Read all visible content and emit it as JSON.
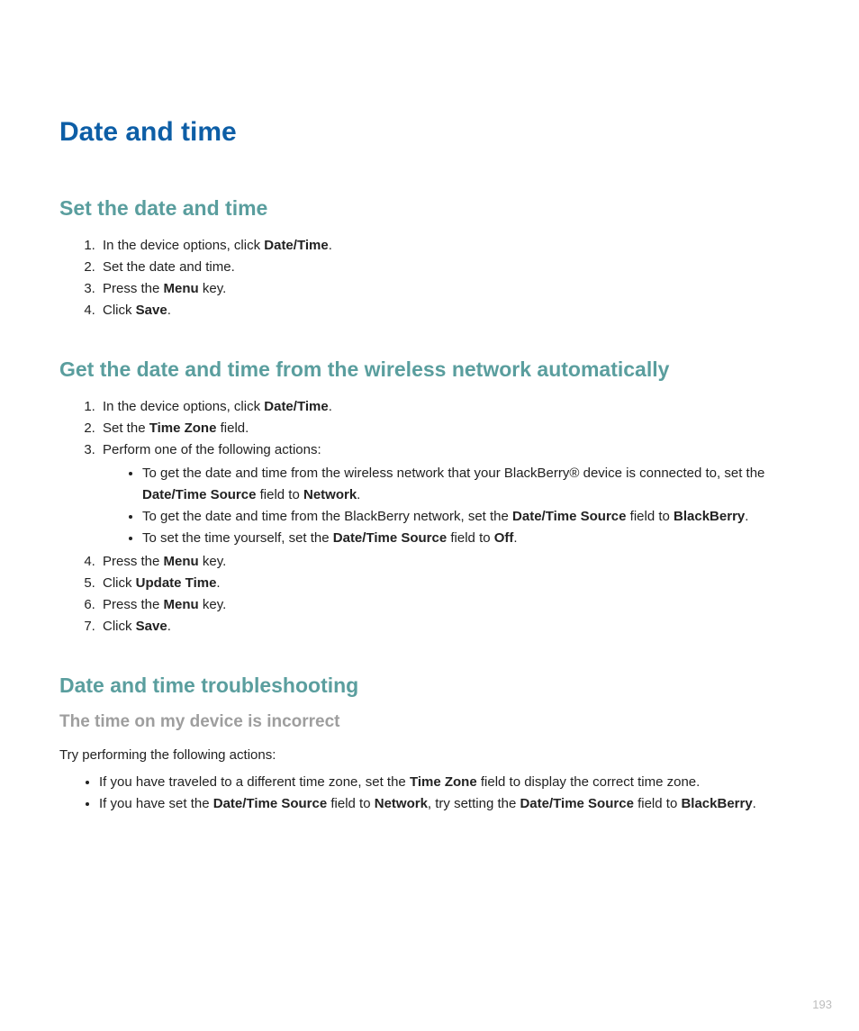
{
  "title": "Date and time",
  "page_number": "193",
  "s1": {
    "heading": "Set the date and time",
    "step1a": "In the device options, click ",
    "step1b": "Date/Time",
    "step1c": ".",
    "step2": "Set the date and time.",
    "step3a": "Press the ",
    "step3b": "Menu",
    "step3c": " key.",
    "step4a": "Click ",
    "step4b": "Save",
    "step4c": "."
  },
  "s2": {
    "heading": "Get the date and time from the wireless network automatically",
    "step1a": "In the device options, click ",
    "step1b": "Date/Time",
    "step1c": ".",
    "step2a": "Set the ",
    "step2b": "Time Zone",
    "step2c": " field.",
    "step3": "Perform one of the following actions:",
    "b1a": "To get the date and time from the wireless network that your BlackBerry® device is connected to, set the ",
    "b1b": "Date/Time Source",
    "b1c": " field to ",
    "b1d": "Network",
    "b1e": ".",
    "b2a": "To get the date and time from the BlackBerry network, set the ",
    "b2b": "Date/Time Source",
    "b2c": " field to ",
    "b2d": "BlackBerry",
    "b2e": ".",
    "b3a": "To set the time yourself, set the ",
    "b3b": "Date/Time Source",
    "b3c": " field to ",
    "b3d": "Off",
    "b3e": ".",
    "step4a": "Press the ",
    "step4b": "Menu",
    "step4c": " key.",
    "step5a": "Click ",
    "step5b": "Update Time",
    "step5c": ".",
    "step6a": "Press the ",
    "step6b": "Menu",
    "step6c": " key.",
    "step7a": "Click ",
    "step7b": "Save",
    "step7c": "."
  },
  "s3": {
    "heading": "Date and time troubleshooting",
    "sub": "The time on my device is incorrect",
    "intro": "Try performing the following actions:",
    "b1a": "If you have traveled to a different time zone, set the ",
    "b1b": "Time Zone",
    "b1c": " field to display the correct time zone.",
    "b2a": "If you have set the ",
    "b2b": "Date/Time Source",
    "b2c": " field to ",
    "b2d": "Network",
    "b2e": ", try setting the ",
    "b2f": "Date/Time Source",
    "b2g": " field to ",
    "b2h": "BlackBerry",
    "b2i": "."
  }
}
